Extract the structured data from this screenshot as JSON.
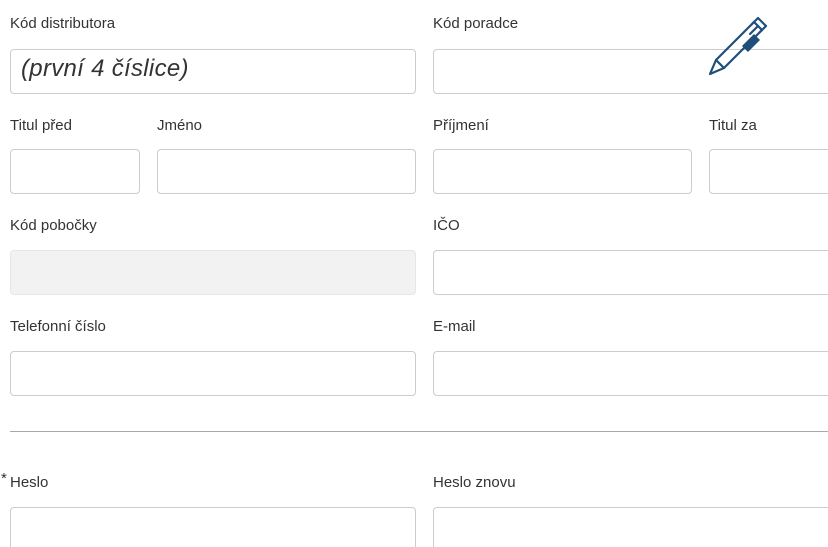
{
  "form": {
    "distributor_code": {
      "label": "Kód distributora",
      "placeholder": "(první 4 číslice)",
      "value": ""
    },
    "advisor_code": {
      "label": "Kód poradce",
      "value": ""
    },
    "title_before": {
      "label": "Titul před",
      "value": ""
    },
    "first_name": {
      "label": "Jméno",
      "value": ""
    },
    "last_name": {
      "label": "Příjmení",
      "value": ""
    },
    "title_after": {
      "label": "Titul za",
      "value": ""
    },
    "branch_code": {
      "label": "Kód pobočky",
      "value": ""
    },
    "ico": {
      "label": "IČO",
      "value": ""
    },
    "phone": {
      "label": "Telefonní číslo",
      "value": ""
    },
    "email": {
      "label": "E-mail",
      "value": ""
    },
    "password": {
      "label": "Heslo",
      "required_mark": "*",
      "value": ""
    },
    "password_repeat": {
      "label": "Heslo znovu",
      "value": ""
    }
  },
  "icons": {
    "pen": "pen-icon",
    "pen_color": "#1f4e79"
  },
  "colors": {
    "border": "#cccccc",
    "disabled_bg": "#f2f2f2",
    "divider": "#aaaaaa",
    "text": "#333333"
  }
}
